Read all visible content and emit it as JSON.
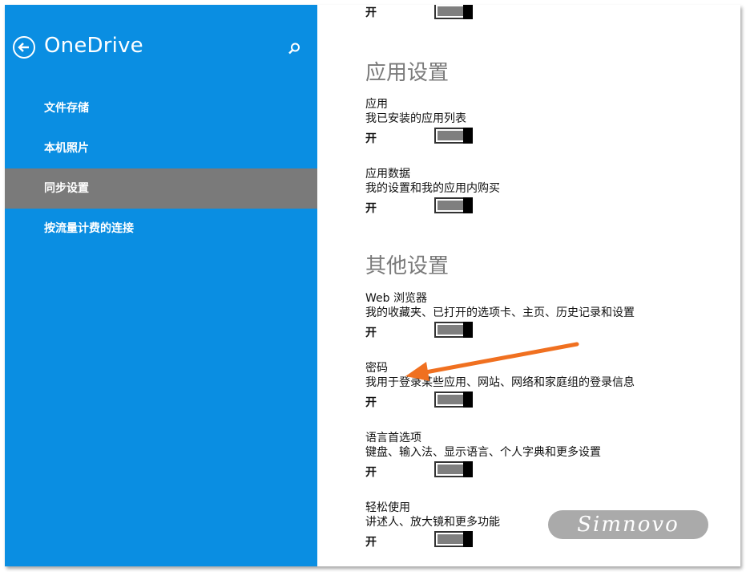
{
  "app": {
    "title": "OneDrive",
    "accent_color": "#0a8ee2"
  },
  "header": {
    "back_icon": "back-arrow-circle-icon",
    "search_icon": "search-icon"
  },
  "sidebar": {
    "items": [
      {
        "label": "文件存储",
        "active": false
      },
      {
        "label": "本机照片",
        "active": false
      },
      {
        "label": "同步设置",
        "active": true
      },
      {
        "label": "按流量计费的连接",
        "active": false
      }
    ]
  },
  "content": {
    "top_toggle_state": "开",
    "sections": [
      {
        "title": "应用设置",
        "settings": [
          {
            "name": "应用",
            "desc": "我已安装的应用列表",
            "state": "开"
          },
          {
            "name": "应用数据",
            "desc": "我的设置和我的应用内购买",
            "state": "开"
          }
        ]
      },
      {
        "title": "其他设置",
        "settings": [
          {
            "name": "Web 浏览器",
            "desc": "我的收藏夹、已打开的选项卡、主页、历史记录和设置",
            "state": "开"
          },
          {
            "name": "密码",
            "desc": "我用于登录某些应用、网站、网络和家庭组的登录信息",
            "state": "开"
          },
          {
            "name": "语言首选项",
            "desc": "键盘、输入法、显示语言、个人字典和更多设置",
            "state": "开"
          },
          {
            "name": "轻松使用",
            "desc": "讲述人、放大镜和更多功能",
            "state": "开"
          }
        ]
      }
    ]
  },
  "annotation": {
    "arrow_color": "#f07020"
  },
  "watermark": {
    "text": "Simnovo"
  }
}
